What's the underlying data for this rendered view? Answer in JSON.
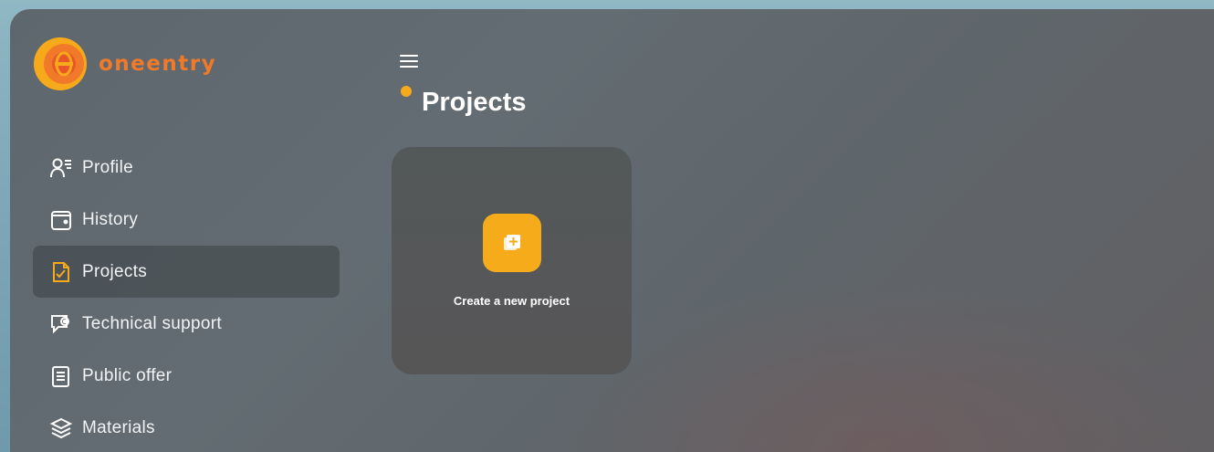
{
  "brand": {
    "name": "oneentry",
    "accent": "#f07a2a",
    "highlight": "#f6a91a"
  },
  "sidebar": {
    "items": [
      {
        "label": "Profile",
        "icon": "profile-icon",
        "active": false
      },
      {
        "label": "History",
        "icon": "wallet-icon",
        "active": false
      },
      {
        "label": "Projects",
        "icon": "projects-icon",
        "active": true
      },
      {
        "label": "Technical support",
        "icon": "support-icon",
        "active": false
      },
      {
        "label": "Public offer",
        "icon": "document-icon",
        "active": false
      },
      {
        "label": "Materials",
        "icon": "layers-icon",
        "active": false
      }
    ]
  },
  "main": {
    "title": "Projects",
    "new_project": {
      "label": "Create a new project",
      "icon": "add-project-icon"
    }
  }
}
